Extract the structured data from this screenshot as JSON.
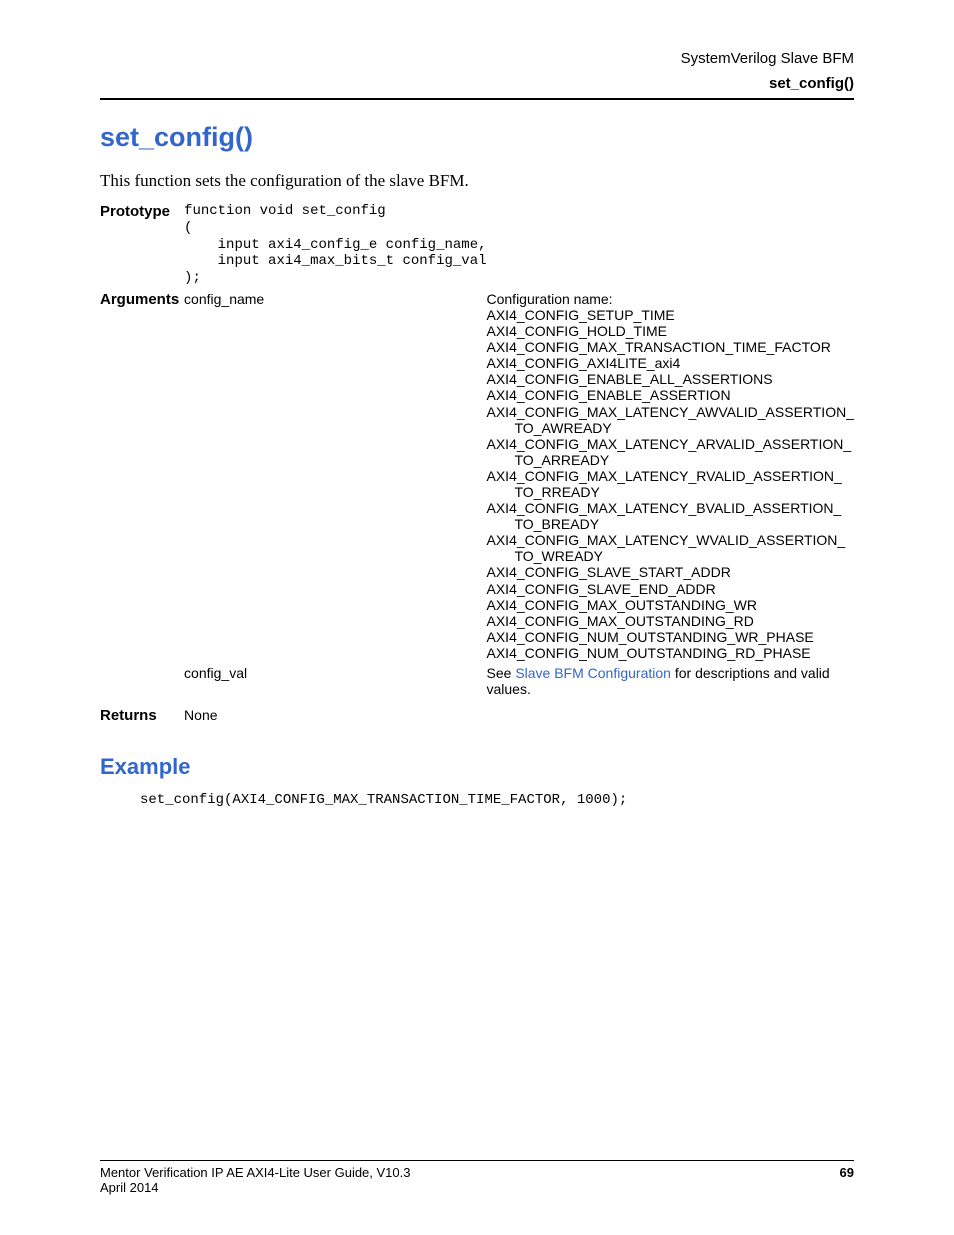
{
  "header": {
    "line1": "SystemVerilog Slave BFM",
    "line2": "set_config()"
  },
  "title": "set_config()",
  "intro": "This function sets the configuration of the slave BFM.",
  "prototype": {
    "label": "Prototype",
    "code": "function void set_config\n(\n    input axi4_config_e config_name,\n    input axi4_max_bits_t config_val\n);"
  },
  "arguments": {
    "label": "Arguments",
    "rows": [
      {
        "name": "config_name",
        "desc_header": "Configuration name:",
        "items": [
          "AXI4_CONFIG_SETUP_TIME",
          "AXI4_CONFIG_HOLD_TIME",
          "AXI4_CONFIG_MAX_TRANSACTION_TIME_FACTOR",
          "AXI4_CONFIG_AXI4LITE_axi4",
          "AXI4_CONFIG_ENABLE_ALL_ASSERTIONS",
          "AXI4_CONFIG_ENABLE_ASSERTION",
          "AXI4_CONFIG_MAX_LATENCY_AWVALID_ASSERTION_",
          "TO_AWREADY",
          "AXI4_CONFIG_MAX_LATENCY_ARVALID_ASSERTION_",
          "TO_ARREADY",
          "AXI4_CONFIG_MAX_LATENCY_RVALID_ASSERTION_",
          "TO_RREADY",
          "AXI4_CONFIG_MAX_LATENCY_BVALID_ASSERTION_",
          "TO_BREADY",
          "AXI4_CONFIG_MAX_LATENCY_WVALID_ASSERTION_",
          "TO_WREADY",
          "AXI4_CONFIG_SLAVE_START_ADDR",
          "AXI4_CONFIG_SLAVE_END_ADDR",
          "AXI4_CONFIG_MAX_OUTSTANDING_WR",
          "AXI4_CONFIG_MAX_OUTSTANDING_RD",
          "AXI4_CONFIG_NUM_OUTSTANDING_WR_PHASE",
          "AXI4_CONFIG_NUM_OUTSTANDING_RD_PHASE"
        ],
        "indent_flags": [
          false,
          false,
          false,
          false,
          false,
          false,
          false,
          true,
          false,
          true,
          false,
          true,
          false,
          true,
          false,
          true,
          false,
          false,
          false,
          false,
          false,
          false
        ]
      },
      {
        "name": "config_val",
        "desc_prefix": "See ",
        "desc_link": "Slave BFM Configuration",
        "desc_suffix": " for descriptions and valid values."
      }
    ]
  },
  "returns": {
    "label": "Returns",
    "value": "None"
  },
  "example": {
    "heading": "Example",
    "code": "set_config(AXI4_CONFIG_MAX_TRANSACTION_TIME_FACTOR, 1000);"
  },
  "footer": {
    "title": "Mentor Verification IP AE AXI4-Lite User Guide, V10.3",
    "date": "April 2014",
    "page": "69"
  }
}
